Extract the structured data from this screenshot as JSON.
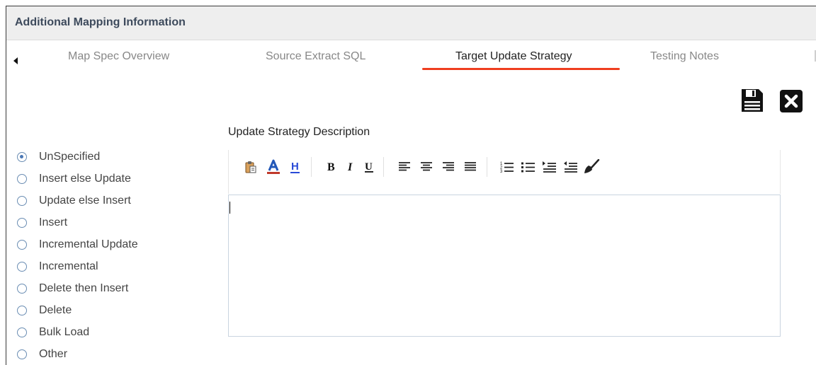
{
  "panel": {
    "title": "Additional Mapping Information"
  },
  "tabs": [
    {
      "label": "Map Spec Overview",
      "active": false
    },
    {
      "label": "Source Extract SQL",
      "active": false
    },
    {
      "label": "Target Update Strategy",
      "active": true
    },
    {
      "label": "Testing Notes",
      "active": false
    }
  ],
  "actions": {
    "save_icon": "save-icon",
    "close_icon": "close-icon"
  },
  "description": {
    "label": "Update Strategy Description",
    "value": ""
  },
  "strategy_options": [
    {
      "label": "UnSpecified",
      "checked": true
    },
    {
      "label": "Insert else Update",
      "checked": false
    },
    {
      "label": "Update else Insert",
      "checked": false
    },
    {
      "label": "Insert",
      "checked": false
    },
    {
      "label": "Incremental Update",
      "checked": false
    },
    {
      "label": "Incremental",
      "checked": false
    },
    {
      "label": "Delete then Insert",
      "checked": false
    },
    {
      "label": "Delete",
      "checked": false
    },
    {
      "label": "Bulk Load",
      "checked": false
    },
    {
      "label": "Other",
      "checked": false
    }
  ],
  "toolbar_icons": [
    "paste-icon",
    "font-color-icon",
    "highlight-icon",
    "bold-icon",
    "italic-icon",
    "underline-icon",
    "align-left-icon",
    "align-center-icon",
    "align-right-icon",
    "align-justify-icon",
    "numbered-list-icon",
    "bulleted-list-icon",
    "indent-icon",
    "outdent-icon",
    "clear-formatting-icon"
  ],
  "colors": {
    "accent": "#ef3e1f",
    "radio": "#4a78b5",
    "font_color_bar": "#c0392b",
    "highlight_blue": "#2a4bd7"
  }
}
